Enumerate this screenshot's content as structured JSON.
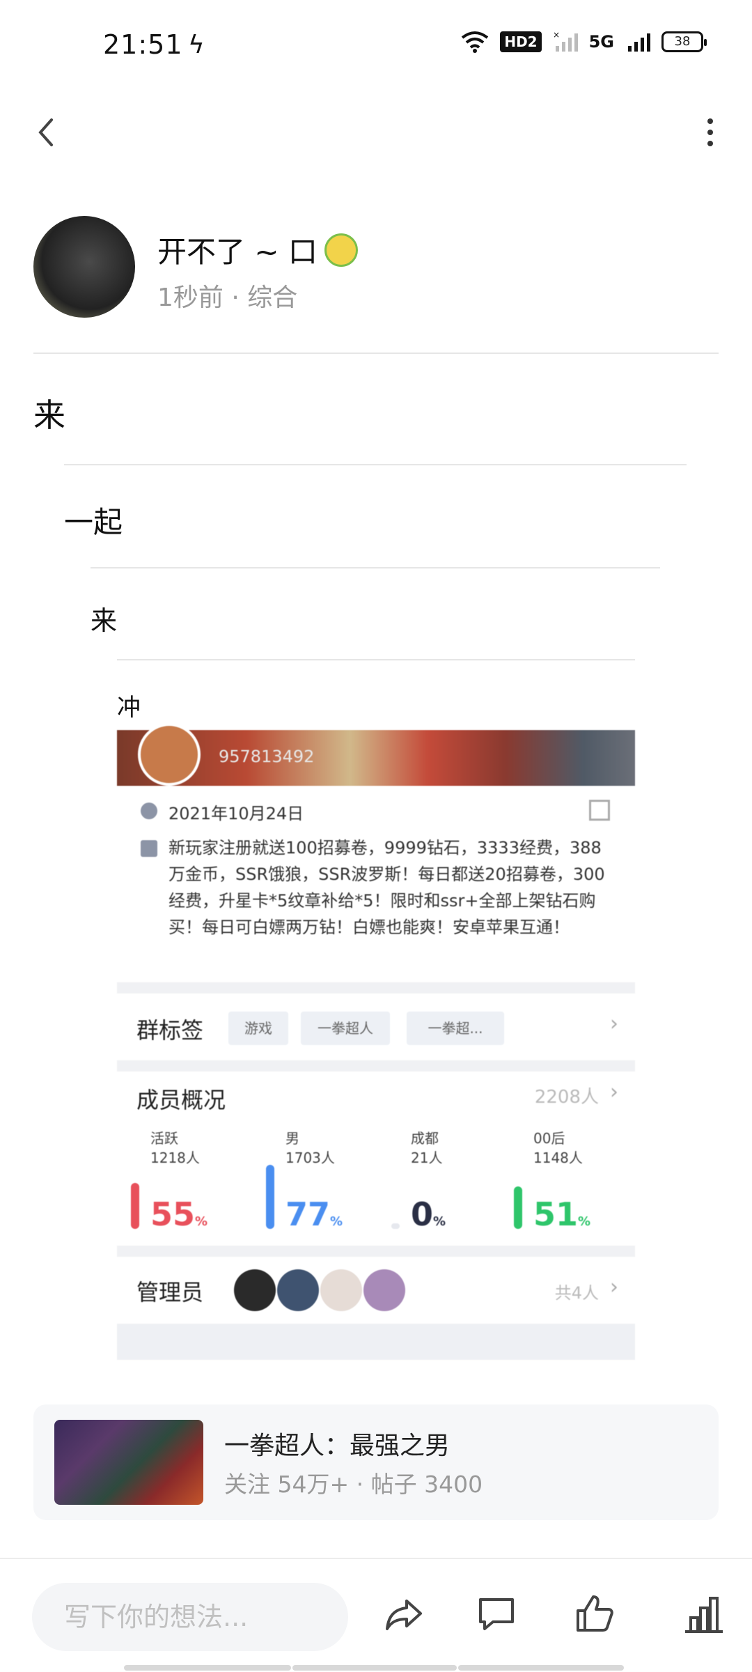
{
  "status_bar": {
    "time": "21:51",
    "hd_badge": "HD2",
    "network": "5G",
    "battery": "38"
  },
  "post": {
    "author_name": "开不了 ~ 口",
    "time_ago": "1秒前",
    "category": "综合",
    "meta_separator": " · ",
    "lines": [
      "来",
      "一起",
      "来",
      "冲"
    ]
  },
  "group_card": {
    "group_id": "957813492",
    "date": "2021年10月24日",
    "description": "新玩家注册就送100招募卷，9999钻石，3333经费，388万金币，SSR饿狼，SSR波罗斯！每日都送20招募卷，300经费，升星卡*5纹章补给*5！限时和ssr+全部上架钻石购买！每日可白嫖两万钻！白嫖也能爽！安卓苹果互通！",
    "tags_label": "群标签",
    "tags": [
      "游戏",
      "一拳超人",
      "一拳超..."
    ],
    "members_label": "成员概况",
    "members_total": "2208人",
    "stats": [
      {
        "title": "活跃",
        "count": "1218人",
        "pct": "55",
        "color": "#e8505b",
        "level": 0.55
      },
      {
        "title": "男",
        "count": "1703人",
        "pct": "77",
        "color": "#4a8ef0",
        "level": 0.77
      },
      {
        "title": "成都",
        "count": "21人",
        "pct": "0",
        "color": "#2a2f45",
        "level": 0.0
      },
      {
        "title": "00后",
        "count": "1148人",
        "pct": "51",
        "color": "#2ec56a",
        "level": 0.51
      }
    ],
    "pct_suffix": "%",
    "admins_label": "管理员",
    "admins_count": "共4人"
  },
  "forum": {
    "name": "一拳超人：最强之男",
    "followers": "关注 54万+",
    "posts": "帖子 3400",
    "separator": " · "
  },
  "bottom_bar": {
    "comment_placeholder": "写下你的想法..."
  }
}
